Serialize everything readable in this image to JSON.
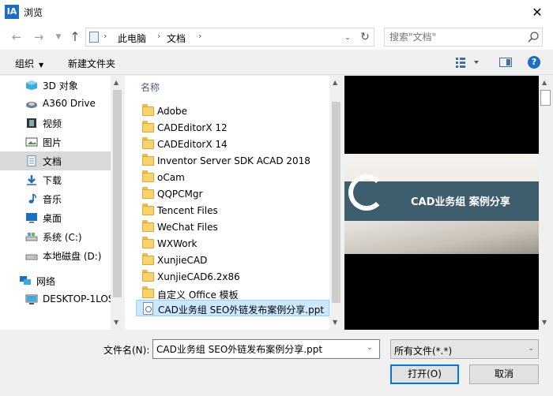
{
  "window": {
    "title": "浏览",
    "app_icon": "IA"
  },
  "address": {
    "crumbs": [
      "此电脑",
      "文档"
    ],
    "search_placeholder": "搜索\"文档\""
  },
  "toolbar": {
    "organize": "组织",
    "new_folder": "新建文件夹"
  },
  "nav": {
    "items": [
      {
        "label": "3D 对象",
        "icon": "3d-objects-icon"
      },
      {
        "label": "A360 Drive",
        "icon": "cloud-drive-icon"
      },
      {
        "label": "视频",
        "icon": "video-icon"
      },
      {
        "label": "图片",
        "icon": "pictures-icon"
      },
      {
        "label": "文档",
        "icon": "documents-icon",
        "selected": true
      },
      {
        "label": "下载",
        "icon": "download-icon"
      },
      {
        "label": "音乐",
        "icon": "music-icon"
      },
      {
        "label": "桌面",
        "icon": "desktop-icon"
      },
      {
        "label": "系统 (C:)",
        "icon": "drive-icon"
      },
      {
        "label": "本地磁盘 (D:)",
        "icon": "drive-icon"
      },
      {
        "label": "网络",
        "icon": "network-icon"
      },
      {
        "label": "DESKTOP-1LOS",
        "icon": "computer-icon"
      }
    ]
  },
  "files": {
    "column_header": "名称",
    "items": [
      {
        "name": "Adobe",
        "type": "folder"
      },
      {
        "name": "CADEditorX 12",
        "type": "folder"
      },
      {
        "name": "CADEditorX 14",
        "type": "folder"
      },
      {
        "name": "Inventor Server SDK ACAD 2018",
        "type": "folder"
      },
      {
        "name": "oCam",
        "type": "folder"
      },
      {
        "name": "QQPCMgr",
        "type": "folder"
      },
      {
        "name": "Tencent Files",
        "type": "folder"
      },
      {
        "name": "WeChat Files",
        "type": "folder"
      },
      {
        "name": "WXWork",
        "type": "folder"
      },
      {
        "name": "XunjieCAD",
        "type": "folder"
      },
      {
        "name": "XunjieCAD6.2x86",
        "type": "folder"
      },
      {
        "name": "自定义 Office 模板",
        "type": "folder"
      },
      {
        "name": "CAD业务组 SEO外链发布案例分享.ppt",
        "type": "file",
        "selected": true
      }
    ]
  },
  "preview": {
    "banner_text": "CAD业务组 案例分享",
    "accent": "#3e5e6e"
  },
  "bottom": {
    "filename_label": "文件名(N):",
    "filename_value": "CAD业务组 SEO外链发布案例分享.ppt",
    "filetype": "所有文件(*.*)",
    "open_label": "打开(O)",
    "cancel_label": "取消"
  }
}
